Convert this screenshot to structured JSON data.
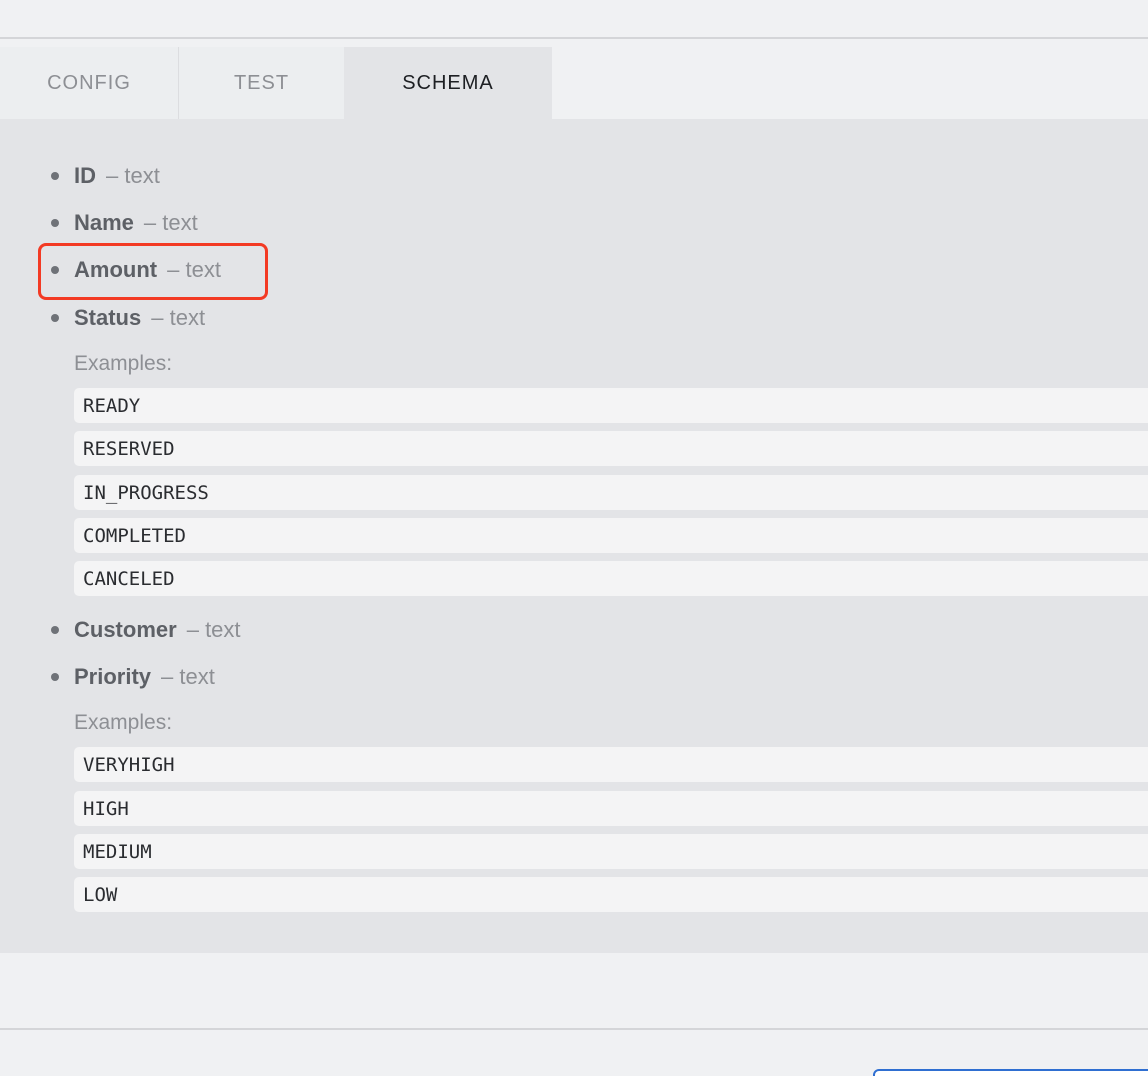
{
  "tabs": [
    {
      "label": "CONFIG",
      "active": false
    },
    {
      "label": "TEST",
      "active": false
    },
    {
      "label": "SCHEMA",
      "active": true
    }
  ],
  "schema": {
    "fields": [
      {
        "name": "ID",
        "type": "text"
      },
      {
        "name": "Name",
        "type": "text"
      },
      {
        "name": "Amount",
        "type": "text",
        "highlighted": true
      },
      {
        "name": "Status",
        "type": "text",
        "examples_label": "Examples:",
        "examples": [
          "READY",
          "RESERVED",
          "IN_PROGRESS",
          "COMPLETED",
          "CANCELED"
        ]
      },
      {
        "name": "Customer",
        "type": "text"
      },
      {
        "name": "Priority",
        "type": "text",
        "examples_label": "Examples:",
        "examples": [
          "VERYHIGH",
          "HIGH",
          "MEDIUM",
          "LOW"
        ]
      }
    ],
    "separator": "–"
  },
  "colors": {
    "highlight_border": "#f33a24",
    "button_border": "#2f6fd1"
  }
}
